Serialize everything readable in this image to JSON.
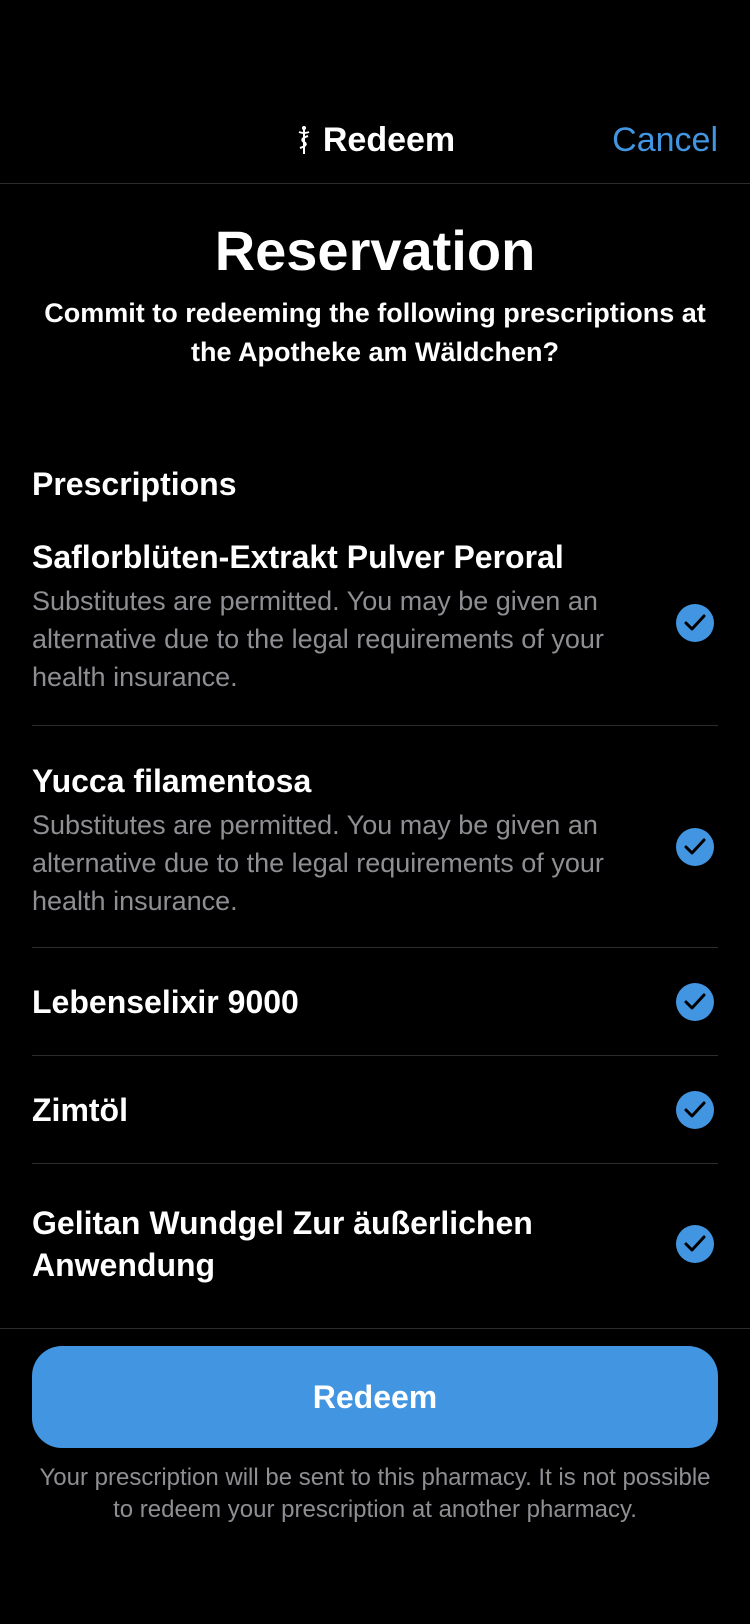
{
  "theme": {
    "accent": "#4295E0",
    "background": "#000000",
    "secondary_text": "#8E8E93",
    "separator": "#2C2C2E"
  },
  "nav": {
    "title": "Redeem",
    "title_icon": "caduceus-icon",
    "cancel_label": "Cancel"
  },
  "header": {
    "title": "Reservation",
    "subtitle": "Commit to redeeming the following prescriptions at the Apotheke am Wäldchen?"
  },
  "prescriptions": {
    "section_title": "Prescriptions",
    "items": [
      {
        "name": "Saflorblüten-Extrakt Pulver Peroral",
        "description": "Substitutes are permitted. You may be given an alternative due to the legal requirements of your health insurance.",
        "checked": true
      },
      {
        "name": "Yucca filamentosa",
        "description": "Substitutes are permitted. You may be given an alternative due to the legal requirements of your health insurance.",
        "checked": true
      },
      {
        "name": "Lebenselixir 9000",
        "description": "",
        "checked": true
      },
      {
        "name": "Zimtöl",
        "description": "",
        "checked": true
      },
      {
        "name": "Gelitan Wundgel Zur äußerlichen Anwendung",
        "description": "",
        "checked": true
      }
    ]
  },
  "footer": {
    "redeem_label": "Redeem",
    "note": "Your prescription will be sent to this pharmacy. It is not possible to redeem your prescription at another pharmacy."
  }
}
